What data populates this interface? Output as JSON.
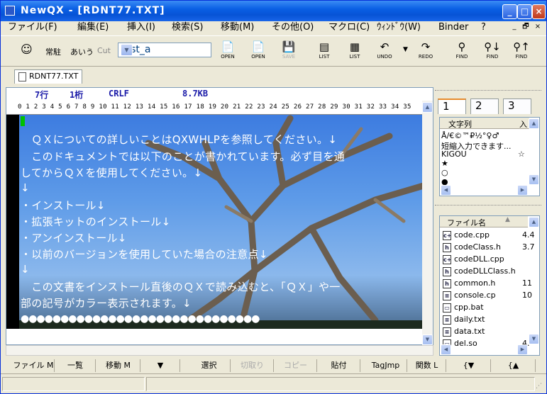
{
  "window": {
    "title": "NewQX - [RDNT77.TXT]"
  },
  "menu": [
    "ファイル(F)",
    "編集(E)",
    "挿入(I)",
    "検索(S)",
    "移動(M)",
    "その他(O)",
    "マクロ(C)",
    "ｳｨﾝﾄﾞｳ(W)",
    "Binder",
    "?"
  ],
  "mdi_buttons": [
    "_",
    "🗗",
    "×"
  ],
  "toolbar": {
    "mode1": "常駐",
    "mode2": "あいう",
    "mode3": "Cut",
    "combo_value": "test_a",
    "buttons": [
      {
        "label": "OPEN",
        "icon": "open-icon",
        "glyph": "📄"
      },
      {
        "label": "OPEN",
        "icon": "open-icon",
        "glyph": "📄"
      },
      {
        "label": "SAVE",
        "icon": "save-icon",
        "glyph": "💾"
      },
      {
        "label": "LIST",
        "icon": "list-icon",
        "glyph": "▤"
      },
      {
        "label": "LIST",
        "icon": "list-icon",
        "glyph": "▦"
      },
      {
        "label": "UNDO",
        "icon": "undo-icon",
        "glyph": "↶"
      },
      {
        "label": "REDO",
        "icon": "redo-icon",
        "glyph": "↷"
      },
      {
        "label": "FIND",
        "icon": "find-icon",
        "glyph": "⚲"
      },
      {
        "label": "FIND",
        "icon": "find-icon",
        "glyph": "⚲↓"
      },
      {
        "label": "FIND",
        "icon": "find-icon",
        "glyph": "⚲↑"
      }
    ]
  },
  "tab": {
    "label": "RDNT77.TXT"
  },
  "editor": {
    "status": {
      "row": "7行",
      "col": "1桁",
      "eol": "CRLF",
      "size": "8.7KB"
    },
    "ruler": "0  1  2  3  4  5  6  7  8  9  10 11 12 13 14 15 16 17 18 19 20 21 22 23 24 25 26 27 28 29 30 31 32 33 34 35",
    "lines": [
      "　ＱＸについての詳しいことはQXWHLPを参照してください。↓",
      "　このドキュメントでは以下のことが書かれています。必ず目を通",
      "してからＱＸを使用してください。↓",
      "↓",
      "・インストール↓",
      "・拡張キットのインストール↓",
      "・アンインストール↓",
      "・以前のバージョンを使用していた場合の注意点↓",
      "↓",
      "　この文書をインストール直後のＱＸで読み込むと、「ＱＸ」や一",
      "部の記号がカラー表示されます。↓"
    ],
    "circles": "●●●●●●●●●●●●●●●●●●●●●●●●●●●●●●"
  },
  "function_keys": [
    "ファイル M",
    "一覧",
    "移動 M",
    "▼",
    "選択",
    "切取り",
    "コピー",
    "貼付",
    "TagJmp",
    "関数 L",
    "{▼",
    "{▲"
  ],
  "panel1": {
    "tabs": [
      "1",
      "2",
      "3"
    ],
    "header": "文字列",
    "header2": "入",
    "rows": [
      {
        "text": "Å/€©™₽½°♀♂",
        "val": ""
      },
      {
        "text": "短縮入力できます...",
        "val": ""
      },
      {
        "text": "KIGOU",
        "val": "☆"
      },
      {
        "text": "★",
        "val": ""
      },
      {
        "text": "○",
        "val": ""
      },
      {
        "text": "●",
        "val": ""
      }
    ]
  },
  "panel2": {
    "header": "ファイル名",
    "files": [
      {
        "name": "code.cpp",
        "icon": "c+",
        "size": "4.4"
      },
      {
        "name": "codeClass.h",
        "icon": "h",
        "size": "3.7"
      },
      {
        "name": "codeDLL.cpp",
        "icon": "c+",
        "size": ""
      },
      {
        "name": "codeDLLClass.h",
        "icon": "h",
        "size": ""
      },
      {
        "name": "common.h",
        "icon": "h",
        "size": "11"
      },
      {
        "name": "console.cp",
        "icon": "≡",
        "size": "10"
      },
      {
        "name": "cpp.bat",
        "icon": "▭",
        "size": ""
      },
      {
        "name": "daily.txt",
        "icon": "≡",
        "size": ""
      },
      {
        "name": "data.txt",
        "icon": "≡",
        "size": ""
      },
      {
        "name": "del.so",
        "icon": "▭",
        "size": "4."
      }
    ]
  }
}
